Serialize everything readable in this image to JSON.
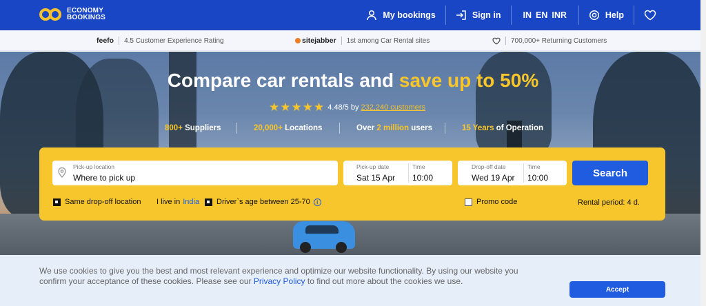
{
  "header": {
    "logo_line1": "ECONOMY",
    "logo_line2": "BOOKINGS",
    "my_bookings": "My bookings",
    "sign_in": "Sign in",
    "lang_country": "IN",
    "lang_language": "EN",
    "lang_currency": "INR",
    "help": "Help",
    "accent_color": "#1846c4"
  },
  "trust": {
    "feefo_brand": "feefo",
    "feefo_text": "4.5 Customer Experience Rating",
    "sitejabber_brand": "sitejabber",
    "sitejabber_text": "1st among Car Rental sites",
    "customers_text": "700,000+ Returning Customers"
  },
  "hero": {
    "title_main": "Compare car rentals and ",
    "title_accent": "save up to 50%",
    "rating_value": "4.48/5 by",
    "rating_link": "232,240 customers",
    "stars": "★★★★★",
    "stats": [
      {
        "accent": "800+",
        "text": " Suppliers"
      },
      {
        "accent": "20,000+",
        "text": " Locations"
      },
      {
        "pre": "Over ",
        "accent": "2 million",
        "text": " users"
      },
      {
        "accent": "15 Years",
        "text": " of Operation"
      }
    ]
  },
  "search": {
    "pickup_label": "Pick-up location",
    "pickup_value": "Where to pick up",
    "pickup_date_label": "Pick-up date",
    "pickup_date": "Sat 15 Apr",
    "pickup_time_label": "Time",
    "pickup_time": "10:00",
    "dropoff_date_label": "Drop-off date",
    "dropoff_date": "Wed 19 Apr",
    "dropoff_time_label": "Time",
    "dropoff_time": "10:00",
    "search_button": "Search",
    "same_dropoff": "Same drop-off location",
    "live_in_prefix": "I live in",
    "live_in_country": "India",
    "driver_age": "Driver`s age between 25-70",
    "promo_code": "Promo code",
    "rental_period": "Rental period: 4 d."
  },
  "cookie": {
    "text_before": "We use cookies to give you the best and most relevant experience and optimize our website functionality. By using our website you confirm your acceptance of these cookies. Please see our ",
    "link": "Privacy Policy",
    "text_after": " to find out more about the cookies we use.",
    "accept": "Accept"
  }
}
